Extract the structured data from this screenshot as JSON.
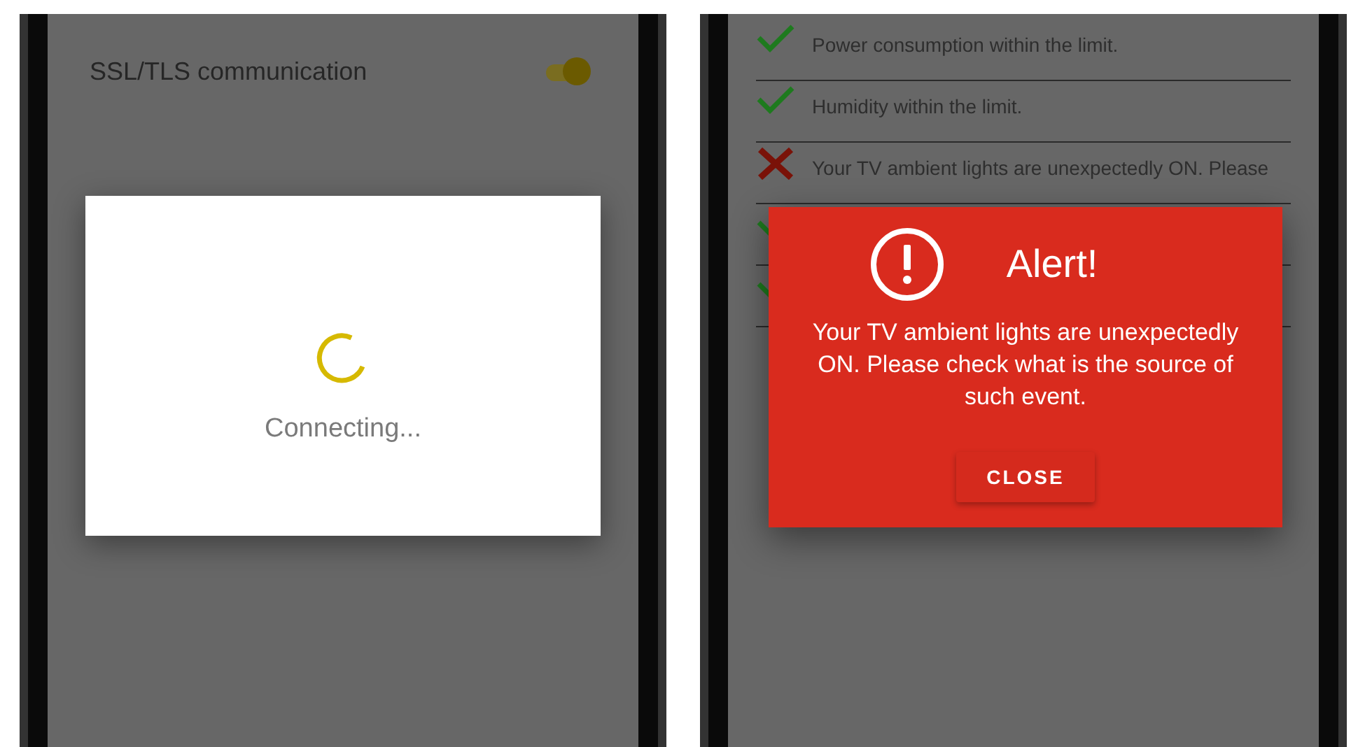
{
  "left_screen": {
    "settings": [
      {
        "label": "SSL/TLS communication",
        "on": true
      }
    ],
    "progress_dialog": {
      "message": "Connecting..."
    }
  },
  "right_screen": {
    "checks": [
      {
        "kind": "ok",
        "text": "Power consumption within the limit."
      },
      {
        "kind": "ok",
        "text": "Humidity within the limit."
      },
      {
        "kind": "error",
        "text": "Your TV ambient lights are unexpectedly ON. Please"
      },
      {
        "kind": "ok"
      },
      {
        "kind": "ok"
      }
    ],
    "alert_dialog": {
      "title": "Alert!",
      "message": "Your TV ambient lights are unexpectedly ON. Please check what is the source of such event.",
      "button": "CLOSE"
    }
  }
}
